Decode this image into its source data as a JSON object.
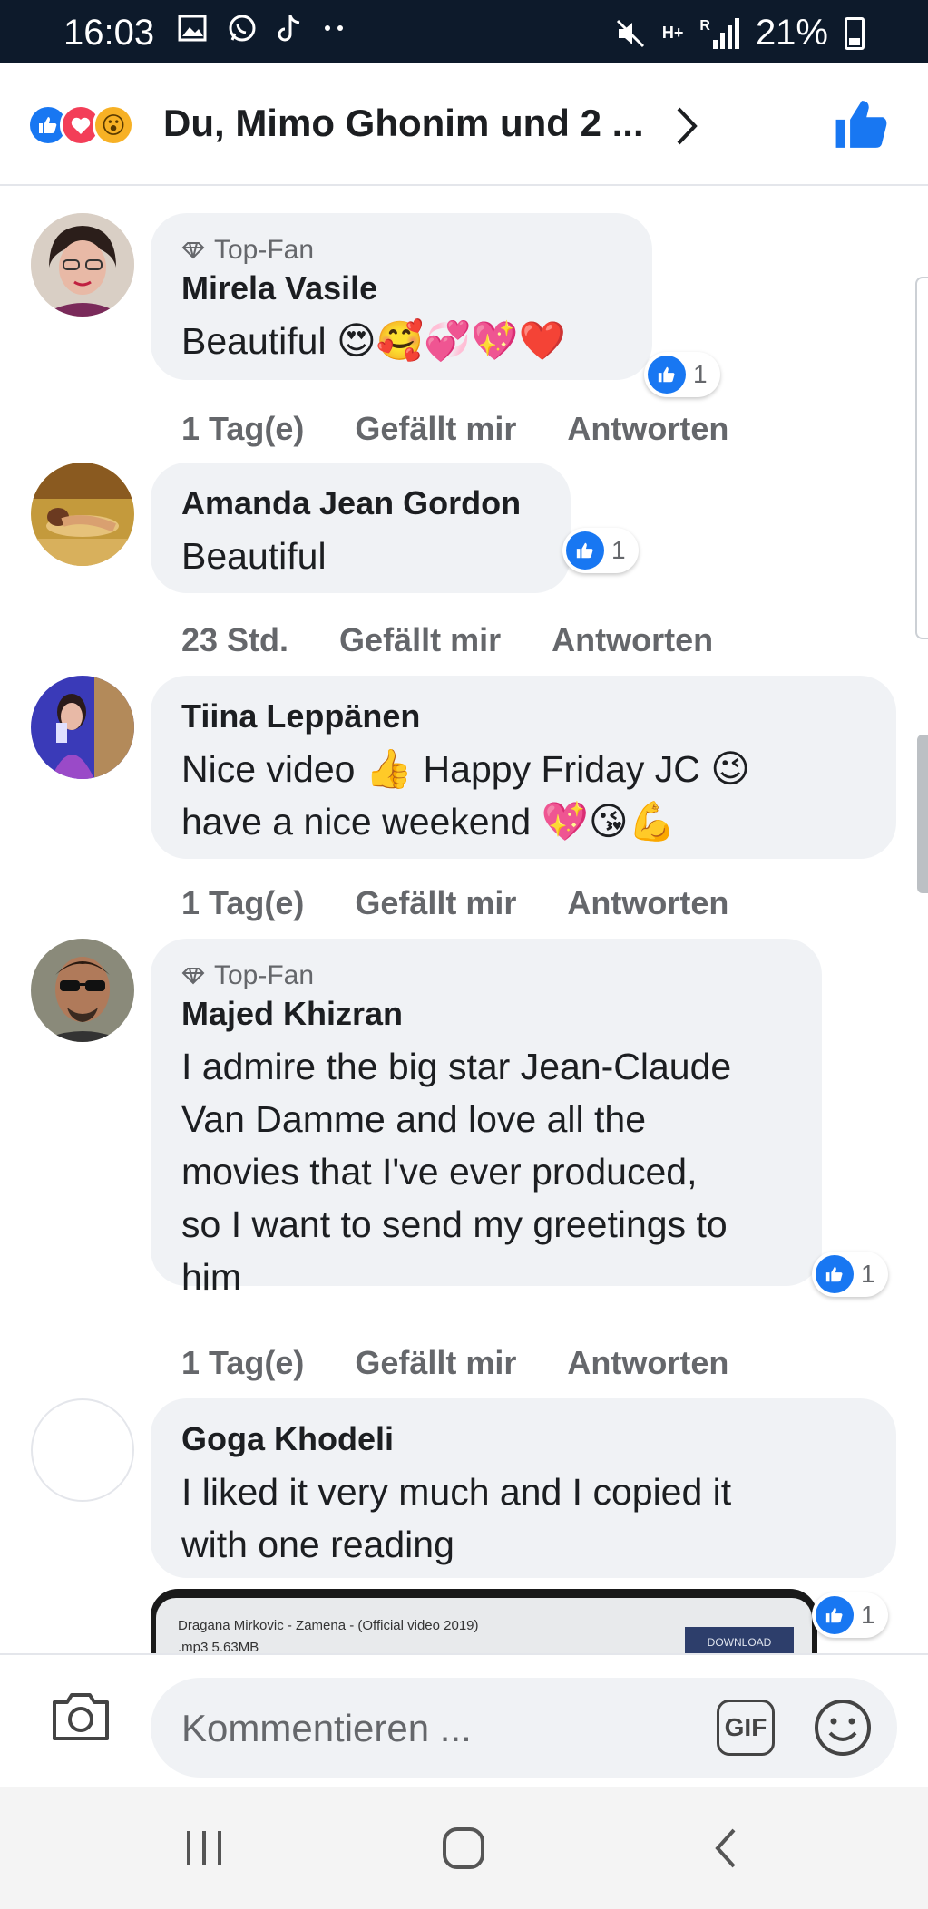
{
  "status_bar": {
    "time": "16:03",
    "network": "H+",
    "roaming": "R",
    "battery": "21%"
  },
  "reactions_header": {
    "names": "Du, Mimo Ghonim und 2 ...",
    "reaction_icons": [
      "like-icon",
      "love-icon",
      "wow-icon"
    ]
  },
  "comments": [
    {
      "badge": "Top-Fan",
      "name": "Mirela Vasile",
      "text": "Beautiful",
      "emojis": "😍🥰💞💖❤️",
      "likes": "1",
      "time": "1 Tag(e)",
      "like_label": "Gefällt mir",
      "reply_label": "Antworten"
    },
    {
      "name": "Amanda Jean Gordon",
      "text": "Beautiful",
      "likes": "1",
      "time": "23 Std.",
      "like_label": "Gefällt mir",
      "reply_label": "Antworten"
    },
    {
      "name": "Tiina Leppänen",
      "text_line1": "Nice video",
      "text_line1_mid": "Happy Friday JC",
      "text_line2": "have a nice weekend",
      "emoji_a": "👍",
      "emoji_b": "😉",
      "emoji_c": "💖😘💪",
      "time": "1 Tag(e)",
      "like_label": "Gefällt mir",
      "reply_label": "Antworten"
    },
    {
      "badge": "Top-Fan",
      "name": "Majed Khizran",
      "text_lines": [
        "I admire the big star Jean-Claude",
        "Van Damme and love all the",
        "movies that I've ever produced,",
        "so I want to send my greetings to",
        "him"
      ],
      "likes": "1",
      "time": "1 Tag(e)",
      "like_label": "Gefällt mir",
      "reply_label": "Antworten"
    },
    {
      "name": "Goga Khodeli",
      "text_lines": [
        "I liked it very much and I copied it",
        "with one reading"
      ],
      "likes": "1",
      "attachment_title": "Dragana Mirkovic - Zamena - (Official video 2019)",
      "attachment_meta": ".mp3  5.63MB",
      "attachment_button": "DOWNLOAD"
    }
  ],
  "composer": {
    "placeholder": "Kommentieren ...",
    "gif_label": "GIF"
  },
  "colors": {
    "accent": "#1877f2",
    "bubble": "#f0f2f5",
    "meta": "#65676b"
  }
}
